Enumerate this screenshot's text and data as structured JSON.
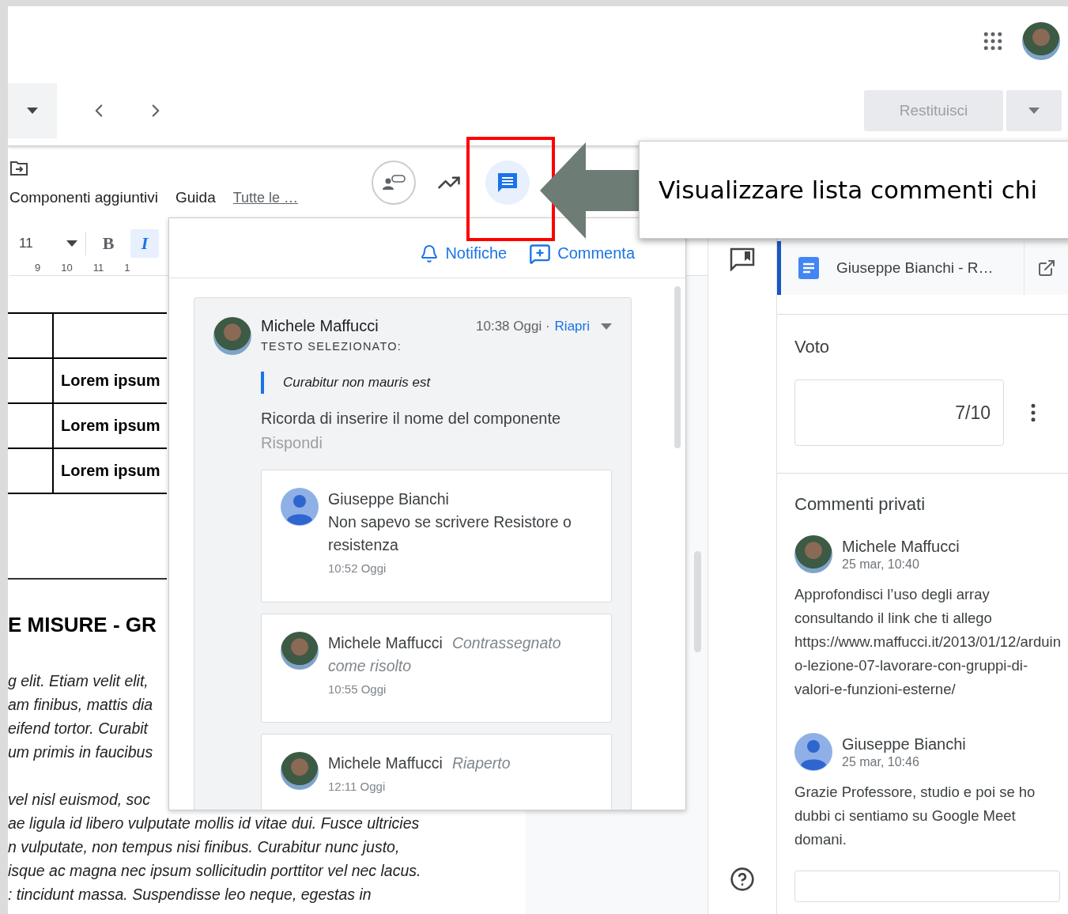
{
  "return_button": {
    "label": "Restituisci",
    "disabled": true
  },
  "doc_toolbar": {
    "menu": [
      {
        "label": "Componenti aggiuntivi",
        "kind": "menu"
      },
      {
        "label": "Guida",
        "kind": "menu"
      },
      {
        "label": "Tutte le …",
        "kind": "link"
      }
    ],
    "comments_panel_open": true,
    "font_size": "11",
    "bold": {
      "label": "B",
      "on": false
    },
    "italic": {
      "label": "I",
      "on": true
    }
  },
  "ruler": [
    "9",
    "10",
    "11",
    "1"
  ],
  "document": {
    "table_rows": [
      "Lorem ipsum",
      "Lorem ipsum",
      "Lorem ipsum"
    ],
    "heading": "E MISURE - GR",
    "paragraph_1": [
      "g elit. Etiam velit elit,",
      "am finibus, mattis dia",
      "eifend tortor. Curabit",
      "um primis in faucibus"
    ],
    "paragraph_2": [
      "vel nisl euismod, soc",
      "ae ligula id libero vulputate mollis id vitae dui. Fusce ultricies",
      "n vulputate, non tempus nisi finibus. Curabitur nunc justo,",
      "isque ac magna nec ipsum sollicitudin porttitor vel nec lacus.",
      ": tincidunt massa. Suspendisse leo neque, egestas in"
    ]
  },
  "comments_popup": {
    "actions": [
      {
        "label": "Notifiche",
        "kind": "bell"
      },
      {
        "label": "Commenta",
        "kind": "add"
      }
    ],
    "thread": {
      "author": "Michele Maffucci",
      "time": "10:38 Oggi",
      "separator": "·",
      "action": "Riapri",
      "selected_label": "TESTO SELEZIONATO:",
      "quote": "Curabitur non mauris est",
      "body": "Ricorda di inserire il nome del componente",
      "reply": "Rispondi",
      "replies": [
        {
          "author": "Giuseppe Bianchi",
          "kind": "default",
          "text": "Non sapevo se scrivere Resistore o resistenza",
          "time": "10:52 Oggi"
        },
        {
          "author": "Michele Maffucci",
          "kind": "photo",
          "status": "Contrassegnato come risolto",
          "time": "10:55 Oggi"
        },
        {
          "author": "Michele Maffucci",
          "kind": "photo",
          "status": "Riaperto",
          "time": "12:11 Oggi"
        }
      ]
    }
  },
  "callout": {
    "text": "Visualizzare lista commenti chi"
  },
  "side_panel": {
    "file_tab": {
      "title": "Giuseppe Bianchi - R…",
      "selected": true
    },
    "grade_label": "Voto",
    "grade": "7/10",
    "private_title": "Commenti privati",
    "comments": [
      {
        "author": "Michele Maffucci",
        "kind": "photo",
        "date": "25 mar, 10:40",
        "text": "Approfondisci l’uso degli array consultando il link che ti allego https://www.maffucci.it/2013/01/12/arduino-lezione-07-lavorare-con-gruppi-di-valori-e-funzioni-esterne/"
      },
      {
        "author": "Giuseppe Bianchi",
        "kind": "default",
        "date": "25 mar, 10:46",
        "text": "Grazie Professore, studio e poi se ho dubbi ci sentiamo su Google Meet domani."
      }
    ]
  }
}
